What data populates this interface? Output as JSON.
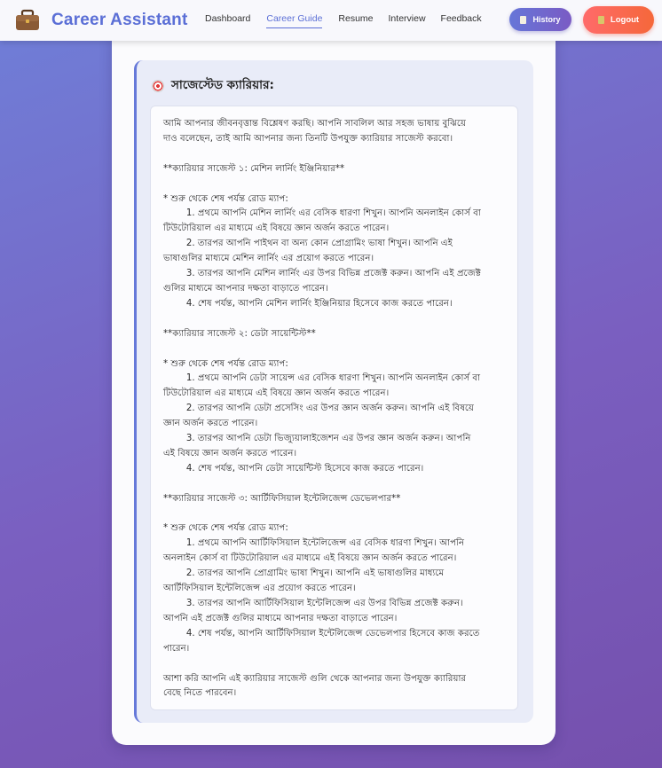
{
  "app": {
    "brand": "Career Assistant",
    "brand_icon": "briefcase-icon"
  },
  "nav": {
    "items": [
      {
        "label": "Dashboard",
        "active": false
      },
      {
        "label": "Career Guide",
        "active": true
      },
      {
        "label": "Resume",
        "active": false
      },
      {
        "label": "Interview",
        "active": false
      },
      {
        "label": "Feedback",
        "active": false
      }
    ],
    "history_label": "History",
    "logout_label": "Logout"
  },
  "result": {
    "icon": "target-icon",
    "title": "সাজেস্টেড ক্যারিয়ার:",
    "body": "আমি আপনার জীবনবৃত্তান্ত বিশ্লেষণ করছি। আপনি সাবলিল আর সহজ ভাষায় বুঝিয়ে\nদাও বলেছেন, তাই আমি আপনার জন্য তিনটি উপযুক্ত ক্যারিয়ার সাজেস্ট করবো।\n\n**ক্যারিয়ার সাজেস্ট ১: মেশিন লার্নিং ইঞ্জিনিয়ার**\n\n* শুরু থেকে শেষ পর্যন্ত রোড ম্যাপ:\n        1. প্রথমে আপনি মেশিন লার্নিং এর বেসিক ধারণা শিখুন। আপনি অনলাইন কোর্স বা\nটিউটোরিয়াল এর মাধ্যমে এই বিষয়ে জ্ঞান অর্জন করতে পারেন।\n        2. তারপর আপনি পাইথন বা অন্য কোন প্রোগ্রামিং ভাষা শিখুন। আপনি এই\nভাষাগুলির মাধ্যমে মেশিন লার্নিং এর প্রয়োগ করতে পারেন।\n        3. তারপর আপনি মেশিন লার্নিং এর উপর বিভিন্ন প্রজেক্ট করুন। আপনি এই প্রজেক্ট\nগুলির মাধ্যমে আপনার দক্ষতা বাড়াতে পারেন।\n        4. শেষ পর্যন্ত, আপনি মেশিন লার্নিং ইঞ্জিনিয়ার হিসেবে কাজ করতে পারেন।\n\n**ক্যারিয়ার সাজেস্ট ২: ডেটা সায়েন্টিস্ট**\n\n* শুরু থেকে শেষ পর্যন্ত রোড ম্যাপ:\n        1. প্রথমে আপনি ডেটা সায়েন্স এর বেসিক ধারণা শিখুন। আপনি অনলাইন কোর্স বা\nটিউটোরিয়াল এর মাধ্যমে এই বিষয়ে জ্ঞান অর্জন করতে পারেন।\n        2. তারপর আপনি ডেটা প্রসেসিং এর উপর জ্ঞান অর্জন করুন। আপনি এই বিষয়ে\nজ্ঞান অর্জন করতে পারেন।\n        3. তারপর আপনি ডেটা ভিজ্যুয়ালাইজেশন এর উপর জ্ঞান অর্জন করুন। আপনি\nএই বিষয়ে জ্ঞান অর্জন করতে পারেন।\n        4. শেষ পর্যন্ত, আপনি ডেটা সায়েন্টিস্ট হিসেবে কাজ করতে পারেন।\n\n**ক্যারিয়ার সাজেস্ট ৩: আর্টিফিসিয়াল ইন্টেলিজেন্স ডেভেলপার**\n\n* শুরু থেকে শেষ পর্যন্ত রোড ম্যাপ:\n        1. প্রথমে আপনি আর্টিফিসিয়াল ইন্টেলিজেন্স এর বেসিক ধারণা শিখুন। আপনি\nঅনলাইন কোর্স বা টিউটোরিয়াল এর মাধ্যমে এই বিষয়ে জ্ঞান অর্জন করতে পারেন।\n        2. তারপর আপনি প্রোগ্রামিং ভাষা শিখুন। আপনি এই ভাষাগুলির মাধ্যমে\nআর্টিফিসিয়াল ইন্টেলিজেন্স এর প্রয়োগ করতে পারেন।\n        3. তারপর আপনি আর্টিফিসিয়াল ইন্টেলিজেন্স এর উপর বিভিন্ন প্রজেক্ট করুন।\nআপনি এই প্রজেক্ট গুলির মাধ্যমে আপনার দক্ষতা বাড়াতে পারেন।\n        4. শেষ পর্যন্ত, আপনি আর্টিফিসিয়াল ইন্টেলিজেন্স ডেভেলপার হিসেবে কাজ করতে\nপারেন।\n\nআশা করি আপনি এই ক্যারিয়ার সাজেস্ট গুলি থেকে আপনার জন্য উপযুক্ত ক্যারিয়ার\nবেছে নিতে পারবেন।"
  },
  "colors": {
    "accent": "#5b6fd6",
    "history_button": "#7068cf",
    "logout_button": "#f8623f"
  }
}
